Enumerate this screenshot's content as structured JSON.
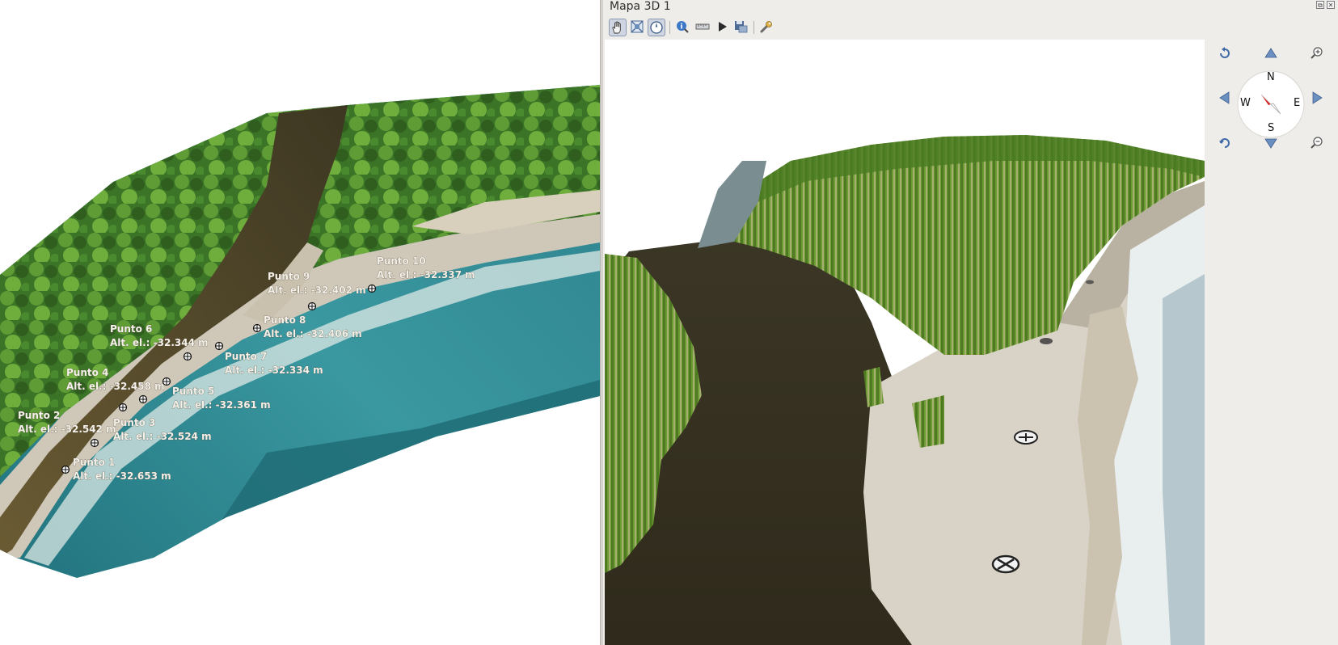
{
  "window": {
    "title": "Mapa 3D 1",
    "float_glyph": "⧉",
    "close_glyph": "✕"
  },
  "toolbar": {
    "buttons": [
      {
        "icon": "pan-hand-icon",
        "active": true
      },
      {
        "icon": "zoom-full-icon",
        "active": false
      },
      {
        "icon": "toggle-on-screen-navigation-icon",
        "active": true
      },
      {
        "icon": "identify-icon",
        "active": false
      },
      {
        "icon": "measure-line-icon",
        "active": false
      },
      {
        "icon": "play-animation-icon",
        "active": false
      },
      {
        "icon": "save-export-icon",
        "active": false
      },
      {
        "icon": "configure-wrench-icon",
        "active": false
      }
    ]
  },
  "compass": {
    "north": "N",
    "south": "S",
    "east": "E",
    "west": "W",
    "needle_color": "#d42020"
  },
  "points": [
    {
      "name": "Punto 1",
      "elevation": "Alt. el.: -32.653 m"
    },
    {
      "name": "Punto 2",
      "elevation": "Alt. el.: -32.542 m"
    },
    {
      "name": "Punto 3",
      "elevation": "Alt. el.: -32.524 m"
    },
    {
      "name": "Punto 4",
      "elevation": "Alt. el.: -32.458 m"
    },
    {
      "name": "Punto 5",
      "elevation": "Alt. el.: -32.361 m"
    },
    {
      "name": "Punto 6",
      "elevation": "Alt. el.: -32.344 m"
    },
    {
      "name": "Punto 7",
      "elevation": "Alt. el.: -32.334 m"
    },
    {
      "name": "Punto 8",
      "elevation": "Alt. el.: -32.406 m"
    },
    {
      "name": "Punto 9",
      "elevation": "Alt. el.: -32.402 m"
    },
    {
      "name": "Punto 10",
      "elevation": "Alt. el.: -32.337 m"
    }
  ],
  "colors": {
    "river": "#4a4128",
    "sea": "#2f8a94",
    "sand": "#cfc8b8",
    "vegetation": "#3f7a28",
    "ui_bg": "#efedea"
  }
}
